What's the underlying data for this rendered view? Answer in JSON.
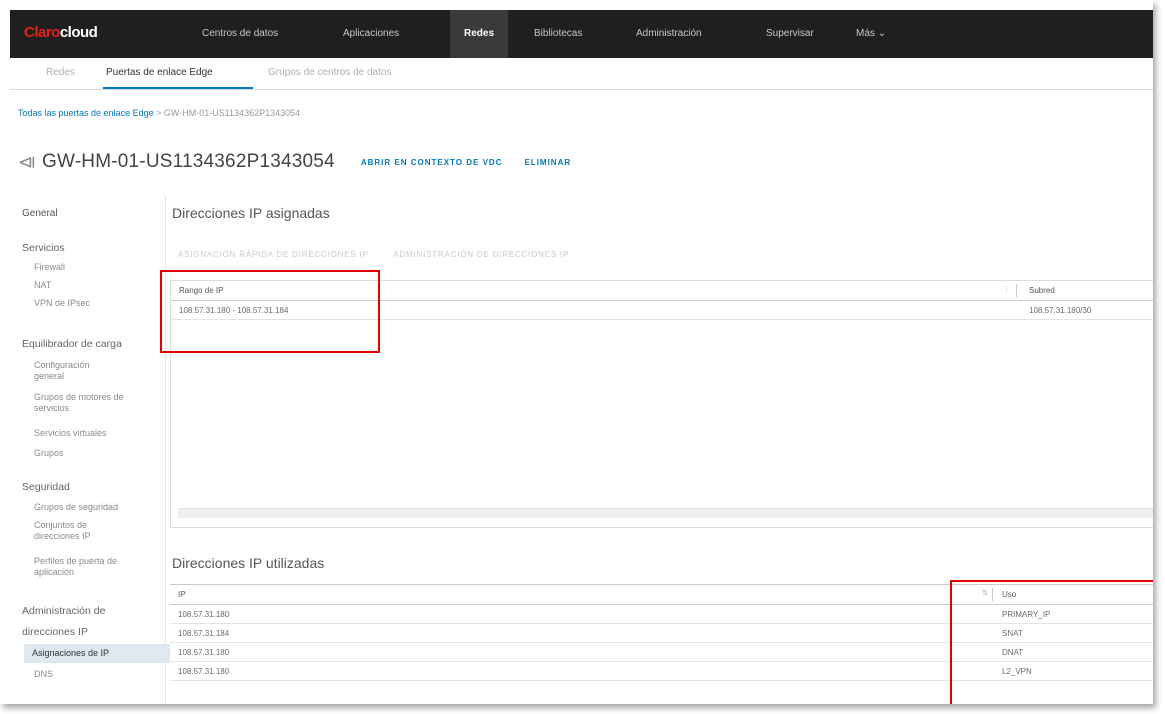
{
  "brand": {
    "name": "Claro",
    "product": "cloud"
  },
  "topnav": [
    {
      "label": "Centros de datos",
      "active": false
    },
    {
      "label": "Aplicaciones",
      "active": false
    },
    {
      "label": "Redes",
      "active": true
    },
    {
      "label": "Bibliotecas",
      "active": false
    },
    {
      "label": "Administración",
      "active": false
    },
    {
      "label": "Supervisar",
      "active": false
    },
    {
      "label": "Más",
      "active": false
    }
  ],
  "subtabs": [
    {
      "label": "Redes",
      "active": false
    },
    {
      "label": "Puertas de enlace Edge",
      "active": true
    },
    {
      "label": "Grupos de centros de datos",
      "active": false
    }
  ],
  "breadcrumb": {
    "parent": "Todas las puertas de enlace Edge",
    "separator": ">",
    "current": "GW-HM-01-US1134362P1343054"
  },
  "page": {
    "title": "GW-HM-01-US1134362P1343054",
    "actions": [
      "ABRIR EN CONTEXTO DE VDC",
      "ELIMINAR"
    ]
  },
  "leftnav": {
    "general": "General",
    "servicios": {
      "label": "Servicios",
      "items": [
        "Firewall",
        "NAT",
        "VPN de IPsec"
      ]
    },
    "balanceador": {
      "label": "Equilibrador de carga",
      "items": [
        "Configuración general",
        "Grupos de motores de servicios",
        "Servicios virtuales",
        "Grupos"
      ]
    },
    "seguridad": {
      "label": "Seguridad",
      "items": [
        "Grupos de seguridad",
        "Conjuntos de direcciones IP",
        "Perfiles de puerta de aplicación"
      ]
    },
    "admin_ip": {
      "label": "Administración de direcciones IP",
      "items": [
        "Asignaciones de IP",
        "DNS"
      ]
    }
  },
  "assigned": {
    "title": "Direcciones IP asignadas",
    "buttons": [
      "ASIGNACIÓN RÁPIDA DE DIRECCIONES IP",
      "ADMINISTRACIÓN DE DIRECCIONES IP"
    ],
    "columns": [
      "Rango de IP",
      "Subred"
    ],
    "rows": [
      {
        "range": "108.57.31.180 - 108.57.31.184",
        "subnet": "108.57.31.180/30"
      }
    ]
  },
  "used": {
    "title": "Direcciones IP utilizadas",
    "columns": [
      "IP",
      "Uso"
    ],
    "rows": [
      {
        "ip": "108.57.31.180",
        "use": "PRIMARY_IP"
      },
      {
        "ip": "108.57.31.184",
        "use": "SNAT"
      },
      {
        "ip": "108.57.31.180",
        "use": "DNAT"
      },
      {
        "ip": "108.57.31.180",
        "use": "L2_VPN"
      }
    ]
  },
  "colors": {
    "accent": "#0079b8",
    "brand_red": "#e2231a",
    "nav_bg": "#1f1f1f",
    "highlight": "#e00000"
  }
}
